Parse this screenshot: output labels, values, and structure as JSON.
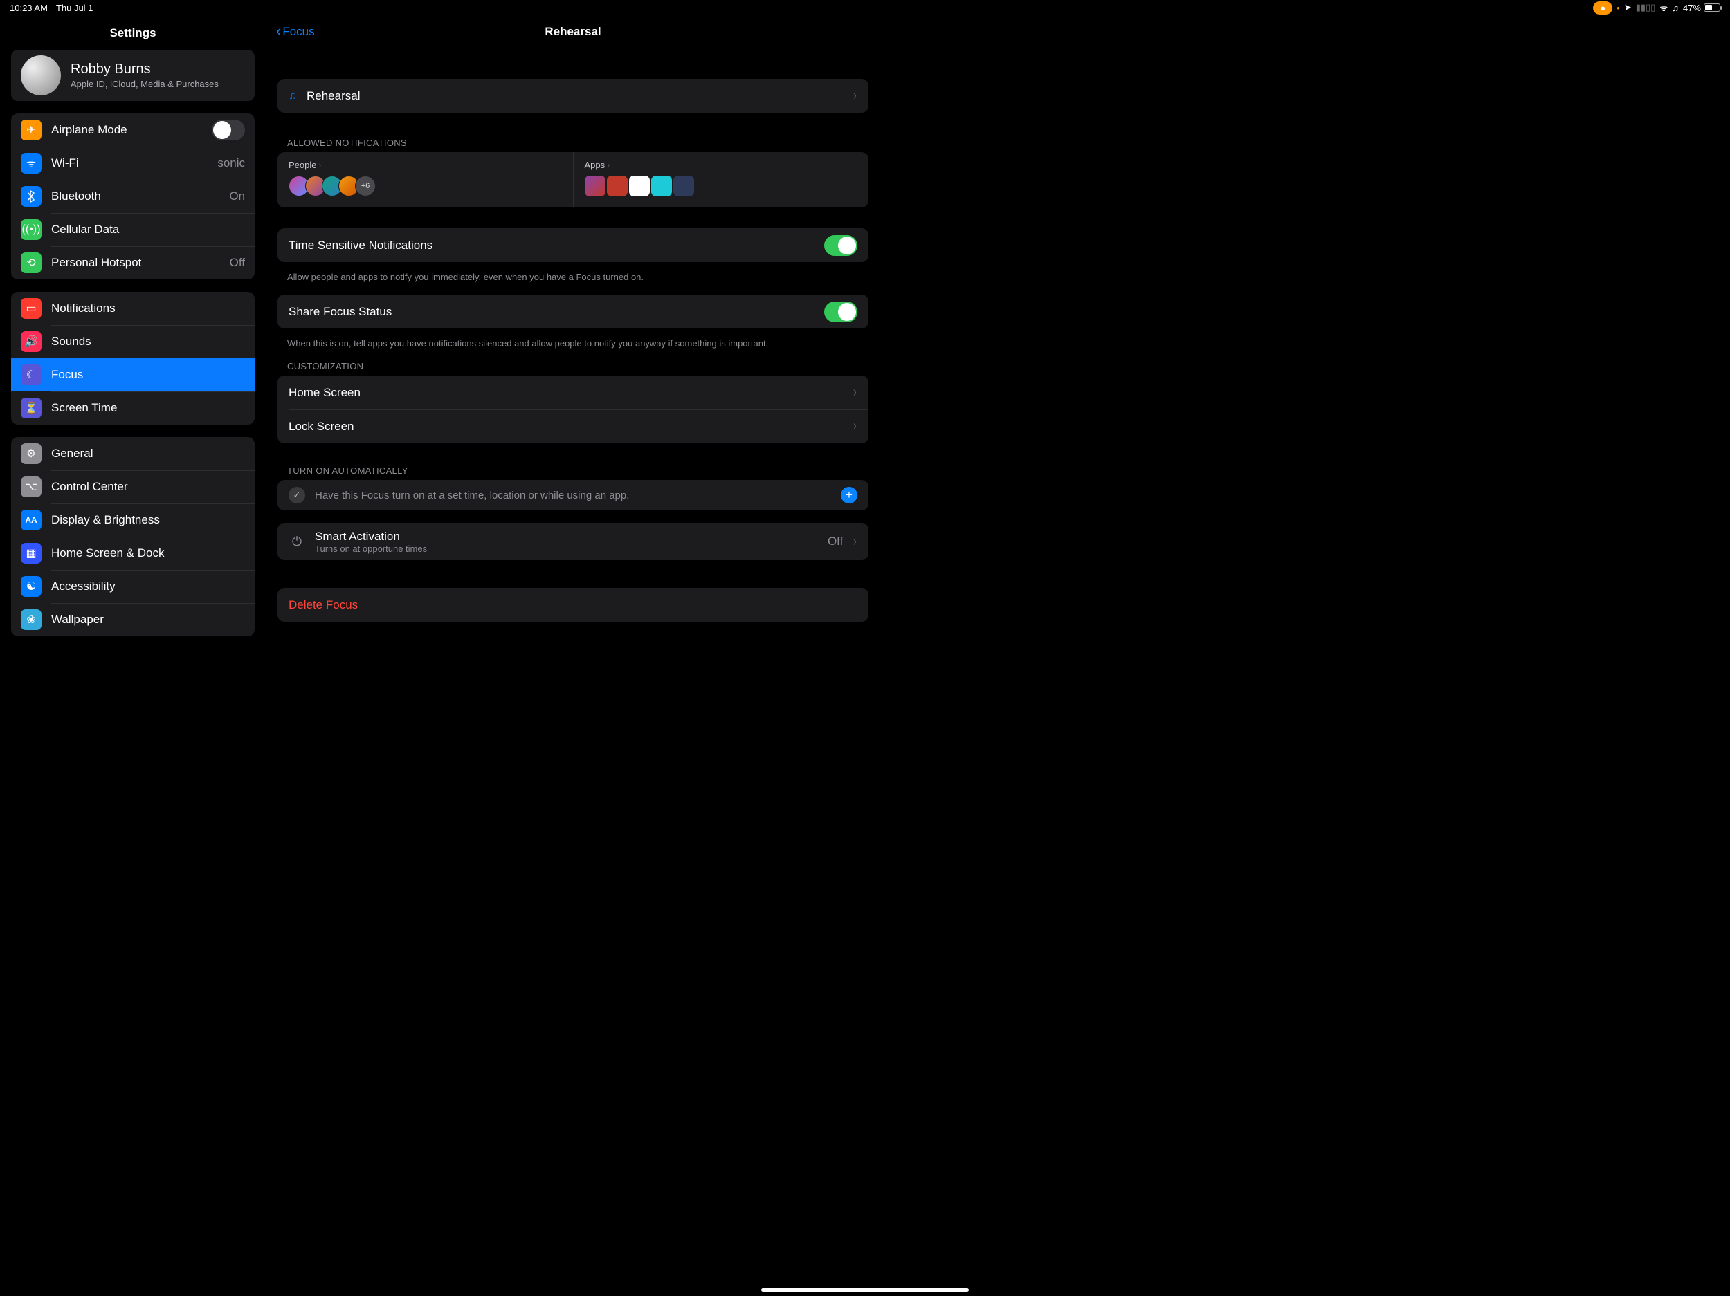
{
  "statusbar": {
    "time": "10:23 AM",
    "date": "Thu Jul 1",
    "battery_pct": "47%"
  },
  "sidebar": {
    "title": "Settings",
    "user": {
      "name": "Robby Burns",
      "subtitle": "Apple ID, iCloud, Media & Purchases"
    },
    "group_connectivity": [
      {
        "id": "airplane",
        "label": "Airplane Mode",
        "value": "",
        "toggle": "off"
      },
      {
        "id": "wifi",
        "label": "Wi-Fi",
        "value": "sonic"
      },
      {
        "id": "bluetooth",
        "label": "Bluetooth",
        "value": "On"
      },
      {
        "id": "cellular",
        "label": "Cellular Data",
        "value": ""
      },
      {
        "id": "hotspot",
        "label": "Personal Hotspot",
        "value": "Off"
      }
    ],
    "group_notif": [
      {
        "id": "notifications",
        "label": "Notifications"
      },
      {
        "id": "sounds",
        "label": "Sounds"
      },
      {
        "id": "focus",
        "label": "Focus",
        "selected": true
      },
      {
        "id": "screentime",
        "label": "Screen Time"
      }
    ],
    "group_general": [
      {
        "id": "general",
        "label": "General"
      },
      {
        "id": "controlcenter",
        "label": "Control Center"
      },
      {
        "id": "display",
        "label": "Display & Brightness"
      },
      {
        "id": "homedock",
        "label": "Home Screen & Dock"
      },
      {
        "id": "accessibility",
        "label": "Accessibility"
      },
      {
        "id": "wallpaper",
        "label": "Wallpaper"
      }
    ]
  },
  "detail": {
    "back": "Focus",
    "title": "Rehearsal",
    "name_row": "Rehearsal",
    "allowed_header": "ALLOWED NOTIFICATIONS",
    "people_label": "People",
    "people_more": "+6",
    "apps_label": "Apps",
    "tsn_label": "Time Sensitive Notifications",
    "tsn_footer": "Allow people and apps to notify you immediately, even when you have a Focus turned on.",
    "share_label": "Share Focus Status",
    "share_footer": "When this is on, tell apps you have notifications silenced and allow people to notify you anyway if something is important.",
    "customization_header": "CUSTOMIZATION",
    "home_screen": "Home Screen",
    "lock_screen": "Lock Screen",
    "auto_header": "TURN ON AUTOMATICALLY",
    "auto_text": "Have this Focus turn on at a set time, location or while using an app.",
    "smart_label": "Smart Activation",
    "smart_sub": "Turns on at opportune times",
    "smart_value": "Off",
    "delete": "Delete Focus"
  }
}
